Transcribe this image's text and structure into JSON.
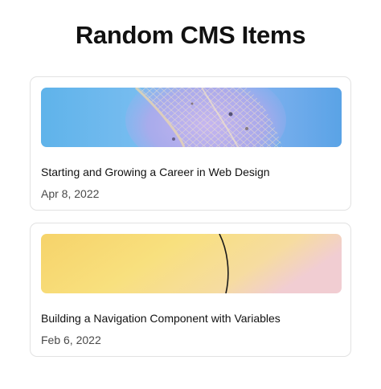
{
  "page": {
    "title": "Random CMS Items"
  },
  "items": [
    {
      "title": "Starting and Growing a Career in Web Design",
      "date": "Apr 8, 2022",
      "image": "blue-leaf-macro-image",
      "accent": "#5aa8e8"
    },
    {
      "title": "Building a Navigation Component with Variables",
      "date": "Feb 6, 2022",
      "image": "yellow-gradient-curve-image",
      "accent": "#f7d46a"
    }
  ]
}
